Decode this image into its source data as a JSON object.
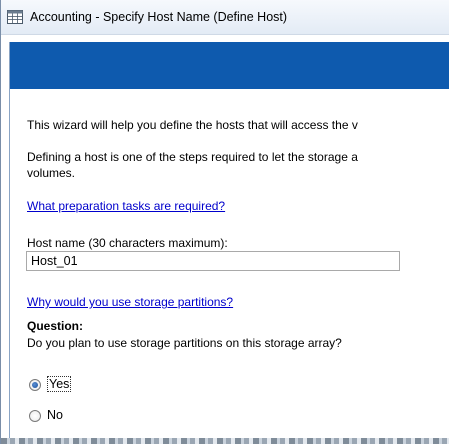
{
  "window": {
    "title": "Accounting - Specify Host Name (Define Host)",
    "banner_color": "#0e5aae",
    "app_icon": "spreadsheet-icon"
  },
  "main": {
    "intro": "This wizard will help you define the hosts that will access the v",
    "defining_line1": "Defining a host is one of the steps required to let the storage a",
    "defining_line2": "volumes.",
    "prep_link": "What preparation tasks are required?",
    "host_label": "Host name (30 characters maximum):",
    "host_value": "Host_01",
    "partitions_link": "Why would you use storage partitions?",
    "question_label": "Question:",
    "question_text": "Do you plan to use storage partitions on this storage array?",
    "options": [
      {
        "label": "Yes",
        "selected": true
      },
      {
        "label": "No",
        "selected": false
      }
    ],
    "link_color": "#0000cc"
  }
}
